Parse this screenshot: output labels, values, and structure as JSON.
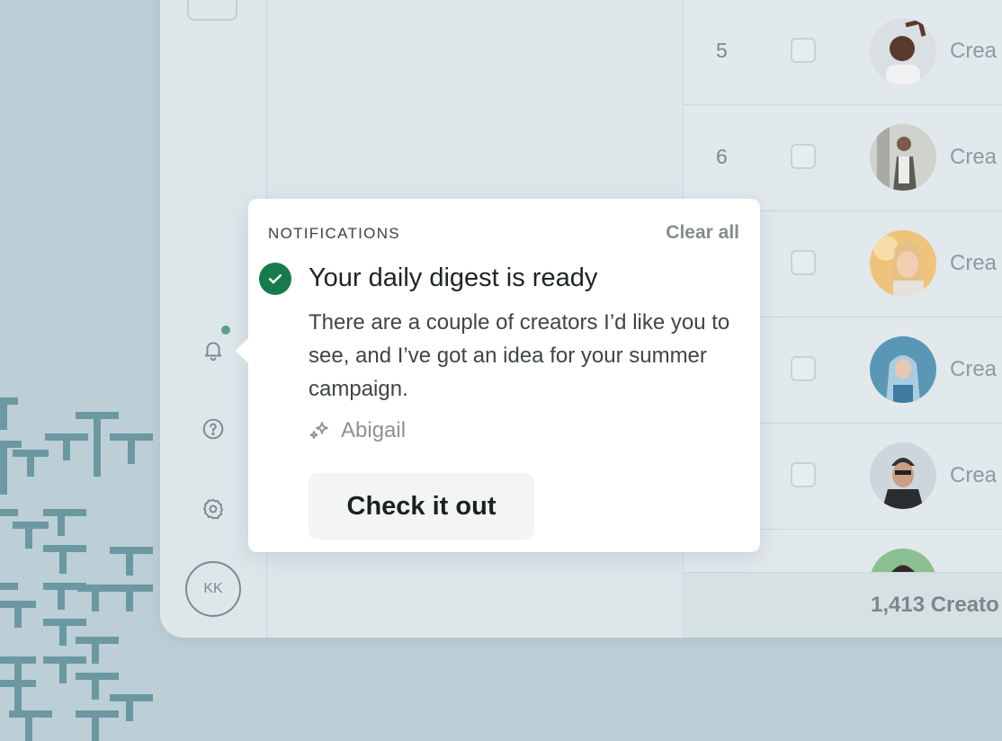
{
  "rail": {
    "add_label": "+",
    "avatar_initials": "KK"
  },
  "table": {
    "rows": [
      {
        "num": "5",
        "label": "Crea"
      },
      {
        "num": "6",
        "label": "Crea"
      },
      {
        "num": "",
        "label": "Crea"
      },
      {
        "num": "",
        "label": "Crea"
      },
      {
        "num": "",
        "label": "Crea"
      }
    ],
    "footer_count": "1,413 Creato"
  },
  "notifications": {
    "title": "NOTIFICATIONS",
    "clear_all": "Clear all",
    "item": {
      "title": "Your daily digest is ready",
      "body": "There are a couple of creators I’d like you to see, and I’ve got an idea for your summer campaign.",
      "sender": "Abigail",
      "cta": "Check it out"
    }
  },
  "colors": {
    "background": "#bccfd6",
    "success": "#167a4c",
    "status_dot": "#5f9e86"
  },
  "icons": [
    "bell-icon",
    "help-icon",
    "settings-icon",
    "check-icon",
    "sparkle-icon"
  ]
}
